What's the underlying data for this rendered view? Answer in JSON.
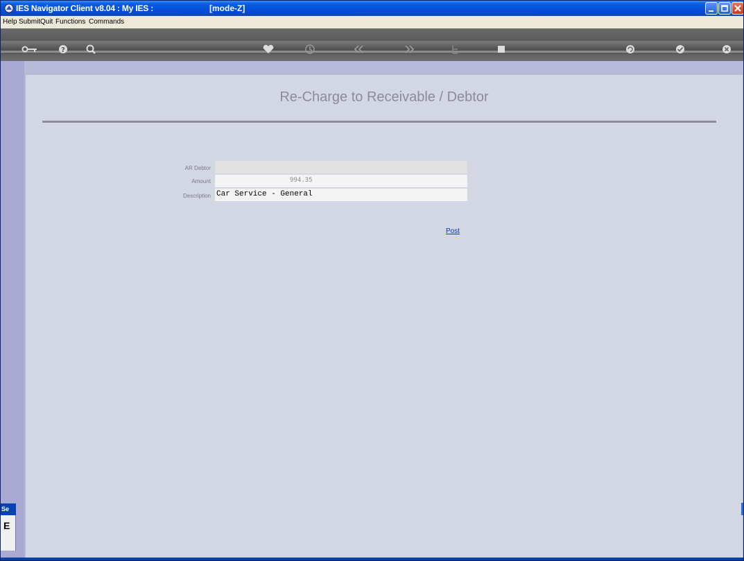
{
  "window": {
    "title": "IES Navigator Client v8.04 : My IES :",
    "mode": "[mode-Z]"
  },
  "menu": [
    "Help",
    "Submit",
    "Quit",
    "Functions",
    "Commands"
  ],
  "toolbar": {
    "icons": [
      "key-icon",
      "help-icon",
      "search-icon",
      "heart-icon",
      "clock-icon",
      "back-icon",
      "forward-icon",
      "tree-icon",
      "stop-icon",
      "refresh-icon",
      "check-icon",
      "close-icon"
    ]
  },
  "form": {
    "title": "Re-Charge to Receivable / Debtor",
    "ar_debtor_label": "AR Debtor",
    "ar_debtor_value": "",
    "amount_label": "Amount",
    "amount_value": "994.35",
    "description_label": "Description",
    "description_value": "Car Service - General",
    "post_label": "Post"
  },
  "side_panel": {
    "tab_label": "Se",
    "content": "E"
  }
}
